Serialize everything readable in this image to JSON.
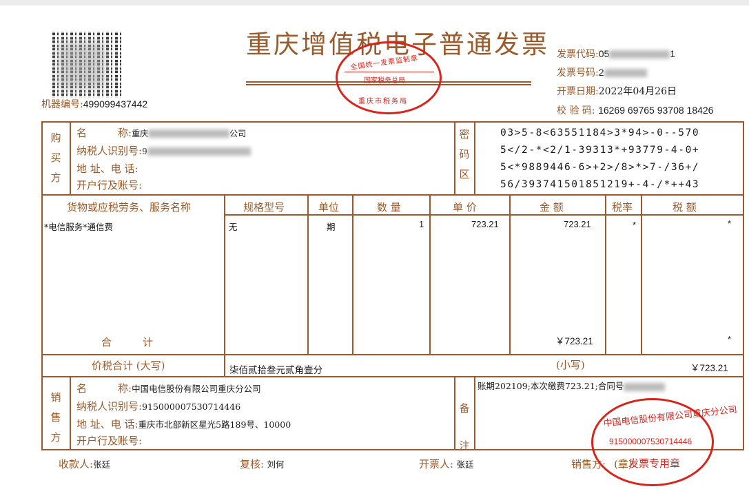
{
  "header": {
    "title": "重庆增值税电子普通发票",
    "machine_label": "机器编号:",
    "machine_no": "499099437442",
    "code_label": "发票代码:",
    "code_prefix": "05",
    "code_suffix": "1",
    "number_label": "发票号码:",
    "number_prefix": "2",
    "date_label": "开票日期:",
    "date": "2022年04月26日",
    "check_label": "校 验 码:",
    "check_code": "16269 69765 93708 18426"
  },
  "tax_seal": {
    "top": "全国统一发票监制章",
    "middle": "国家税务总局",
    "bottom": "重庆市税务局"
  },
  "buyer": {
    "side_label": [
      "购",
      "买",
      "方"
    ],
    "name_label": "名　　　称:",
    "name_value": "重庆",
    "name_tail": "公司",
    "tax_id_label": "纳税人识别号:",
    "tax_id_value": "9",
    "address_label": "地 址、电 话:",
    "bank_label": "开户行及账号:"
  },
  "cipher": {
    "side_label": [
      "密",
      "码",
      "区"
    ],
    "lines": [
      "03>5-8<63551184>3*94>-0--570",
      "5</2-*<2/1-39313*+93779-4-0+",
      "5<*9889446-6>+2>/8>*>7-/36+/",
      "56/393741501851219+-4-/*++43"
    ]
  },
  "items_table": {
    "headers": [
      "货物或应税劳务、服务名称",
      "规格型号",
      "单位",
      "数 量",
      "单 价",
      "金 额",
      "税率",
      "税 额"
    ],
    "rows": [
      {
        "name": "*电信服务*通信费",
        "spec": "无",
        "unit": "期",
        "qty": "1",
        "price": "723.21",
        "amount": "723.21",
        "rate": "*",
        "tax": "*"
      }
    ],
    "total_label": "合　　　计",
    "total_amount": "￥723.21",
    "total_tax": "*"
  },
  "total": {
    "label": "价税合计 (大写)",
    "upper": "柒佰贰拾叁元贰角壹分",
    "small_label": "(小写)",
    "small_value": "￥723.21"
  },
  "seller": {
    "side_label": [
      "销",
      "售",
      "方"
    ],
    "name_label": "名　　　称:",
    "name_value": "中国电信股份有限公司重庆分公司",
    "tax_id_label": "纳税人识别号:",
    "tax_id_value": "915000007530714446",
    "address_label": "地 址、电 话:",
    "address_value": "重庆市北部新区星光5路189号、10000",
    "bank_label": "开户行及账号:"
  },
  "remarks": {
    "side_label": [
      "备",
      "注"
    ],
    "text": "账期202109;本次缴费723.21;合同号"
  },
  "seller_seal": {
    "top": "中国电信股份有限公司重庆分公司",
    "number": "915000007530714446",
    "bottom": "发票专用章"
  },
  "footer": {
    "payee_label": "收款人:",
    "payee": "张廷",
    "reviewer_label": "复核:",
    "reviewer": "刘何",
    "issuer_label": "开票人:",
    "issuer": "张廷",
    "seller_label": "销售方:",
    "seller_stamp": "(章)"
  }
}
